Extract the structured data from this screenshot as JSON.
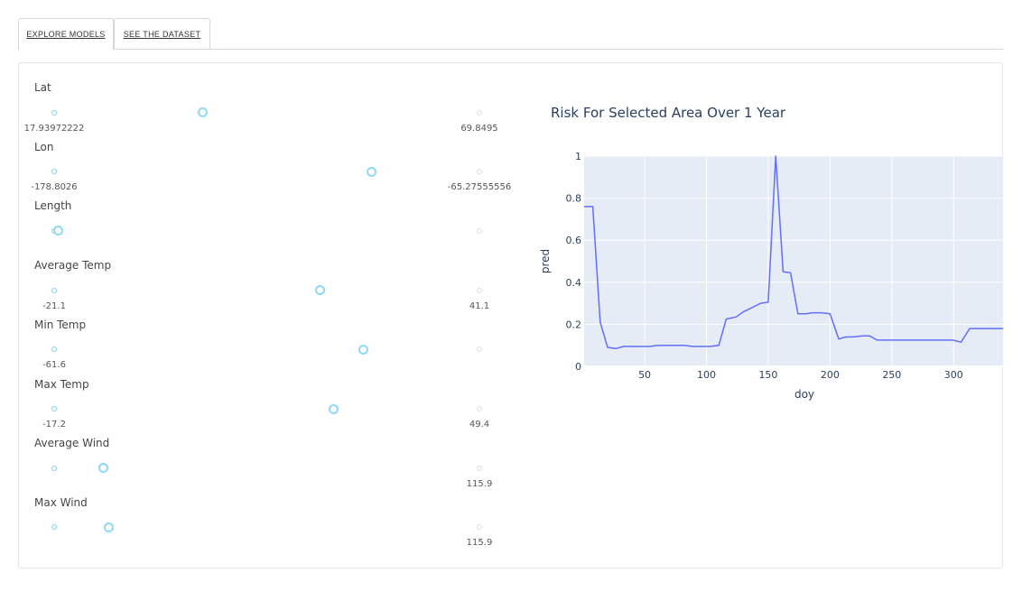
{
  "tabs": [
    {
      "label": "EXPLORE MODELS"
    },
    {
      "label": "SEE THE DATASET"
    }
  ],
  "sliders": [
    {
      "label": "Lat",
      "min_label": "17.93972222",
      "max_label": "69.8495",
      "value_fraction": 0.345
    },
    {
      "label": "Lon",
      "min_label": "-178.8026",
      "max_label": "-65.27555556",
      "value_fraction": 0.742
    },
    {
      "label": "Length",
      "min_label": "",
      "max_label": "",
      "value_fraction": 0.005
    },
    {
      "label": "Average Temp",
      "min_label": "-21.1",
      "max_label": "41.1",
      "value_fraction": 0.62
    },
    {
      "label": "Min Temp",
      "min_label": "-61.6",
      "max_label": "",
      "value_fraction": 0.723
    },
    {
      "label": "Max Temp",
      "min_label": "-17.2",
      "max_label": "49.4",
      "value_fraction": 0.652
    },
    {
      "label": "Average Wind",
      "min_label": "",
      "max_label": "115.9",
      "value_fraction": 0.112
    },
    {
      "label": "Max Wind",
      "min_label": "",
      "max_label": "115.9",
      "value_fraction": 0.125
    }
  ],
  "colors": {
    "line": "#636efa",
    "plot_bg": "#e5ecf6",
    "title": "#2a3f5f",
    "slider_accent": "#8ed8f8"
  },
  "chart_data": {
    "type": "line",
    "title": "Risk For Selected Area Over 1 Year",
    "xlabel": "doy",
    "ylabel": "pred",
    "xlim": [
      1,
      340
    ],
    "ylim": [
      0,
      1
    ],
    "x_ticks": [
      50,
      100,
      150,
      200,
      250,
      300
    ],
    "y_ticks": [
      0,
      0.2,
      0.4,
      0.6,
      0.8,
      1
    ],
    "y_tick_labels": [
      "0",
      "0.2",
      "0.4",
      "0.6",
      "0.8",
      "1"
    ],
    "grid": true,
    "series": [
      {
        "x": [
          1,
          8,
          14,
          20,
          27,
          33,
          40,
          47,
          54,
          61,
          68,
          75,
          82,
          89,
          96,
          103,
          110,
          116,
          124,
          130,
          137,
          144,
          150,
          156,
          162,
          168,
          174,
          180,
          186,
          193,
          200,
          207,
          213,
          219,
          226,
          232,
          238,
          245,
          251,
          258,
          265,
          272,
          279,
          286,
          292,
          299,
          306,
          313,
          320,
          327,
          334,
          340
        ],
        "y": [
          0.76,
          0.76,
          0.21,
          0.09,
          0.085,
          0.095,
          0.095,
          0.095,
          0.095,
          0.1,
          0.1,
          0.1,
          0.1,
          0.095,
          0.095,
          0.095,
          0.1,
          0.225,
          0.235,
          0.26,
          0.28,
          0.3,
          0.305,
          1.0,
          0.45,
          0.445,
          0.25,
          0.25,
          0.255,
          0.255,
          0.25,
          0.13,
          0.14,
          0.14,
          0.145,
          0.145,
          0.125,
          0.125,
          0.125,
          0.125,
          0.125,
          0.125,
          0.125,
          0.125,
          0.125,
          0.125,
          0.115,
          0.18,
          0.18,
          0.18,
          0.18,
          0.18
        ]
      }
    ]
  }
}
